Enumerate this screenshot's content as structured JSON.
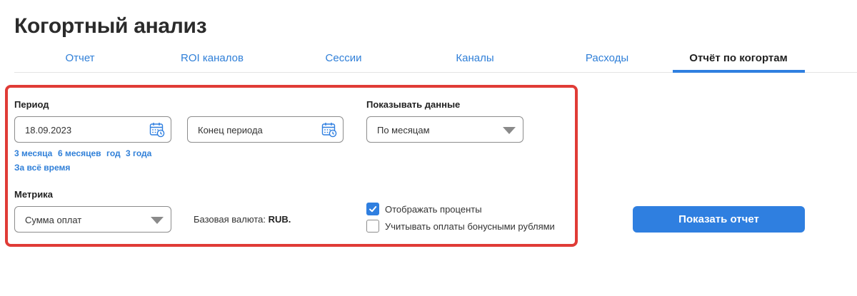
{
  "page": {
    "title": "Когортный анализ"
  },
  "tabs": [
    {
      "label": "Отчет",
      "active": false
    },
    {
      "label": "ROI каналов",
      "active": false
    },
    {
      "label": "Сессии",
      "active": false
    },
    {
      "label": "Каналы",
      "active": false
    },
    {
      "label": "Расходы",
      "active": false
    },
    {
      "label": "Отчёт по когортам",
      "active": true
    }
  ],
  "filters": {
    "period": {
      "label": "Период",
      "start_value": "18.09.2023",
      "end_placeholder": "Конец периода",
      "icon": "calendar-icon"
    },
    "quick_ranges": [
      "3 месяца",
      "6 месяцев",
      "год",
      "3 года",
      "За всё время"
    ],
    "display": {
      "label": "Показывать данные",
      "selected": "По месяцам"
    },
    "metric": {
      "label": "Метрика",
      "selected": "Сумма оплат"
    },
    "currency": {
      "label": "Базовая валюта:",
      "value": "RUB."
    },
    "options": [
      {
        "label": "Отображать проценты",
        "checked": true
      },
      {
        "label": "Учитывать оплаты бонусными рублями",
        "checked": false
      }
    ]
  },
  "actions": {
    "show_report": "Показать отчет"
  },
  "colors": {
    "accent": "#2f7fe0",
    "link": "#2f7fd8",
    "highlight_border": "#e03b36"
  }
}
